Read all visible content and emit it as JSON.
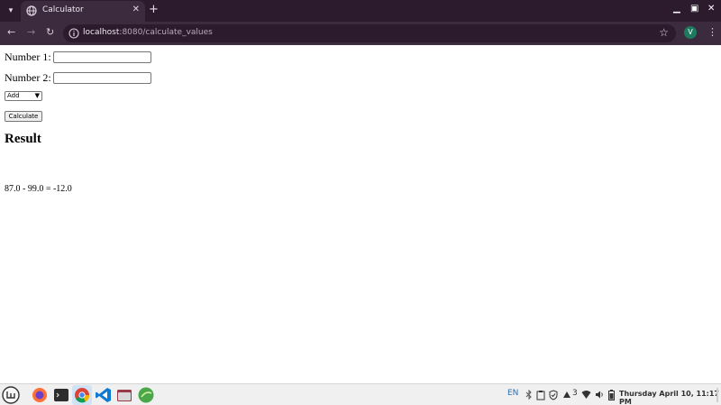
{
  "browser": {
    "tab": {
      "title": "Calculator",
      "close": "✕"
    },
    "new_tab": "+",
    "window_controls": {
      "minimize": "▁",
      "maximize": "▣",
      "close": "✕"
    },
    "nav": {
      "back": "←",
      "forward": "→",
      "reload": "↻"
    },
    "url_host": "localhost",
    "url_path": ":8080/calculate_values",
    "star": "☆",
    "profile_initial": "V",
    "menu": "⋮",
    "tab_menu": "▾"
  },
  "form": {
    "number1_label": "Number 1:",
    "number1_value": "",
    "number2_label": "Number 2:",
    "number2_value": "",
    "operation_selected": "Add",
    "calculate_label": "Calculate"
  },
  "result": {
    "heading": "Result",
    "text": "87.0 - 99.0 = -12.0"
  },
  "taskbar": {
    "language": "EN",
    "notifications_count": "3",
    "clock": "Thursday April 10, 11:17 PM",
    "launchers": [
      "firefox-icon",
      "terminal-icon",
      "chrome-icon",
      "vscode-icon",
      "files-icon",
      "greenfish-icon"
    ]
  },
  "colors": {
    "tabbar_bg": "#2b1b2d",
    "toolbar_bg": "#3c2b3e",
    "avatar_bg": "#1d7a5f"
  }
}
